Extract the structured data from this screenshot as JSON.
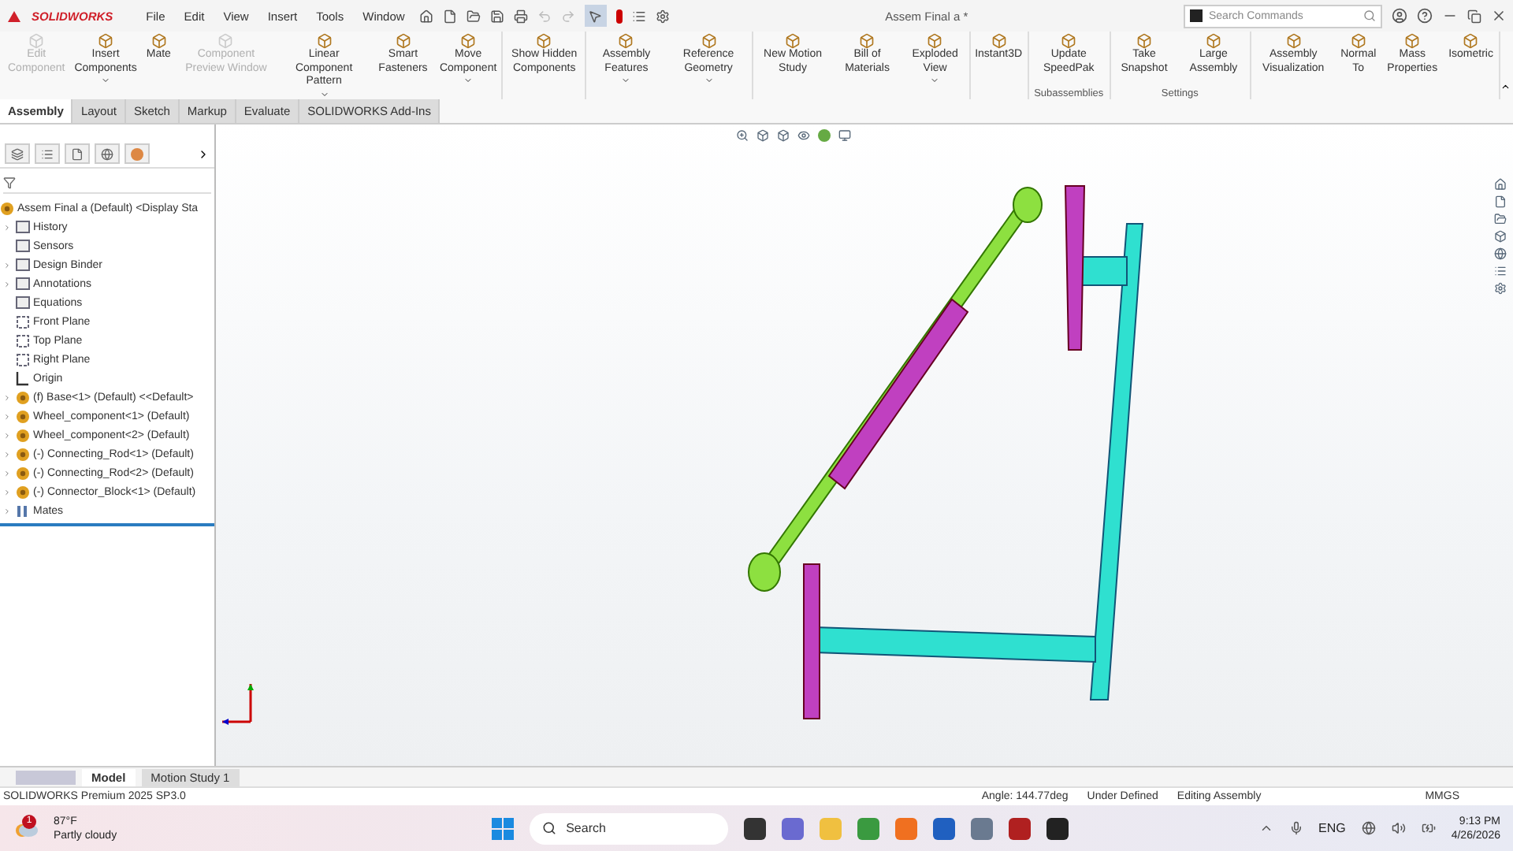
{
  "app_name": "SOLIDWORKS",
  "menus": [
    "File",
    "Edit",
    "View",
    "Insert",
    "Tools",
    "Window"
  ],
  "title": "Assem Final a *",
  "search": {
    "placeholder": "Search Commands"
  },
  "ribbon_groups": [
    {
      "items": [
        {
          "label": "Edit Component",
          "disabled": true,
          "dropdown": false
        },
        {
          "label": "Insert Components",
          "disabled": false,
          "dropdown": true
        },
        {
          "label": "Mate",
          "disabled": false,
          "dropdown": false
        },
        {
          "label": "Component Preview Window",
          "disabled": true,
          "dropdown": false
        },
        {
          "label": "Linear Component Pattern",
          "disabled": false,
          "dropdown": true
        },
        {
          "label": "Smart Fasteners",
          "disabled": false,
          "dropdown": false
        },
        {
          "label": "Move Component",
          "disabled": false,
          "dropdown": true
        }
      ]
    },
    {
      "items": [
        {
          "label": "Show Hidden Components",
          "disabled": false,
          "dropdown": false
        }
      ]
    },
    {
      "items": [
        {
          "label": "Assembly Features",
          "disabled": false,
          "dropdown": true
        },
        {
          "label": "Reference Geometry",
          "disabled": false,
          "dropdown": true
        }
      ]
    },
    {
      "items": [
        {
          "label": "New Motion Study",
          "disabled": false,
          "dropdown": false
        },
        {
          "label": "Bill of Materials",
          "disabled": false,
          "dropdown": false
        },
        {
          "label": "Exploded View",
          "disabled": false,
          "dropdown": true
        }
      ]
    },
    {
      "items": [
        {
          "label": "Instant3D",
          "disabled": false,
          "dropdown": false
        }
      ]
    },
    {
      "caption": "Subassemblies",
      "items": [
        {
          "label": "Update SpeedPak",
          "disabled": false,
          "dropdown": false
        }
      ]
    },
    {
      "caption": "Settings",
      "items": [
        {
          "label": "Take Snapshot",
          "disabled": false,
          "dropdown": false
        },
        {
          "label": "Large Assembly",
          "disabled": false,
          "dropdown": false
        }
      ]
    },
    {
      "items": [
        {
          "label": "Assembly Visualization",
          "disabled": false,
          "dropdown": false
        },
        {
          "label": "Normal To",
          "disabled": false,
          "dropdown": false
        },
        {
          "label": "Mass Properties",
          "disabled": false,
          "dropdown": false
        },
        {
          "label": "Isometric",
          "disabled": false,
          "dropdown": false
        }
      ]
    }
  ],
  "command_tabs": [
    {
      "label": "Assembly",
      "selected": true
    },
    {
      "label": "Layout",
      "selected": false
    },
    {
      "label": "Sketch",
      "selected": false
    },
    {
      "label": "Markup",
      "selected": false
    },
    {
      "label": "Evaluate",
      "selected": false
    },
    {
      "label": "SOLIDWORKS Add-Ins",
      "selected": false
    }
  ],
  "tree": {
    "root": "Assem Final a (Default) <Display Sta",
    "items": [
      {
        "label": "History",
        "kind": "folder",
        "expandable": true
      },
      {
        "label": "Sensors",
        "kind": "folder",
        "expandable": false
      },
      {
        "label": "Design Binder",
        "kind": "folder",
        "expandable": true
      },
      {
        "label": "Annotations",
        "kind": "folder",
        "expandable": true
      },
      {
        "label": "Equations",
        "kind": "folder",
        "expandable": false
      },
      {
        "label": "Front Plane",
        "kind": "plane",
        "expandable": false
      },
      {
        "label": "Top Plane",
        "kind": "plane",
        "expandable": false
      },
      {
        "label": "Right Plane",
        "kind": "plane",
        "expandable": false
      },
      {
        "label": "Origin",
        "kind": "origin",
        "expandable": false
      },
      {
        "label": "(f) Base<1> (Default) <<Default>",
        "kind": "part",
        "expandable": true
      },
      {
        "label": "Wheel_component<1> (Default)",
        "kind": "part",
        "expandable": true
      },
      {
        "label": "Wheel_component<2> (Default)",
        "kind": "part",
        "expandable": true
      },
      {
        "label": "(-) Connecting_Rod<1> (Default)",
        "kind": "part",
        "expandable": true
      },
      {
        "label": "(-) Connecting_Rod<2> (Default)",
        "kind": "part",
        "expandable": true
      },
      {
        "label": "(-) Connector_Block<1> (Default)",
        "kind": "part",
        "expandable": true
      },
      {
        "label": "Mates",
        "kind": "mates",
        "expandable": true
      }
    ]
  },
  "bottom_tabs": [
    {
      "label": "Model",
      "selected": true
    },
    {
      "label": "Motion Study 1",
      "selected": false
    }
  ],
  "status_bar": {
    "product": "SOLIDWORKS Premium 2025 SP3.0",
    "angle": "Angle: 144.77deg",
    "state": "Under Defined",
    "mode": "Editing Assembly",
    "units": "MMGS"
  },
  "taskbar": {
    "weather_badge": "1",
    "temperature": "87°F",
    "condition": "Partly cloudy",
    "search": "Search",
    "language": "ENG",
    "time": "9:13 PM",
    "date": "4/26/2026"
  }
}
